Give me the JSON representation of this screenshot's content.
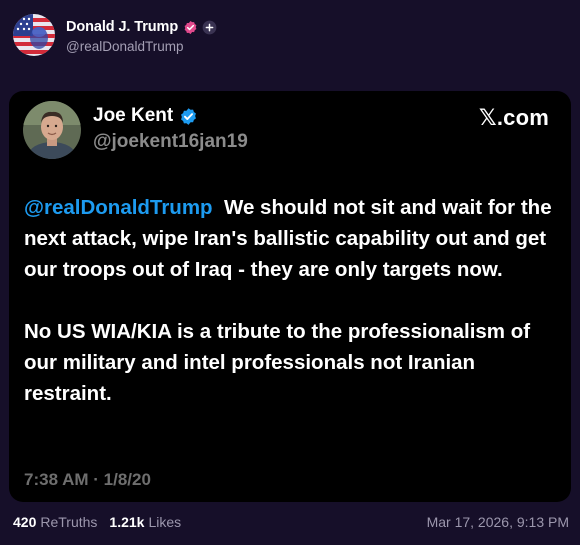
{
  "colors": {
    "background": "#160f29",
    "card_background": "#000000",
    "mention": "#1d9bf0",
    "verified_blue": "#1d9bf0",
    "verified_pink": "#e0498c",
    "muted_text": "#9c97ad"
  },
  "author": {
    "display_name": "Donald J. Trump",
    "handle": "@realDonaldTrump",
    "avatar_icon": "american-flag-avatar-icon",
    "badge_icon": "verified-badge-icon",
    "extra_icon": "plus-icon"
  },
  "quoted": {
    "display_name": "Joe Kent",
    "handle": "@joekent16jan19",
    "source_label": "𝕏.com",
    "mention": "@realDonaldTrump",
    "paragraph1": "We should not sit and wait for the next attack, wipe Iran's ballistic capability out and get our troops out of Iraq - they are only targets now.",
    "paragraph2": "No US WIA/KIA is a tribute to the professionalism of our military and intel professionals not Iranian restraint.",
    "timestamp": "7:38 AM · 1/8/20"
  },
  "stats": {
    "retruths_count": "420",
    "retruths_label": "ReTruths",
    "likes_count": "1.21k",
    "likes_label": "Likes"
  },
  "post_date": "Mar 17, 2026, 9:13 PM"
}
